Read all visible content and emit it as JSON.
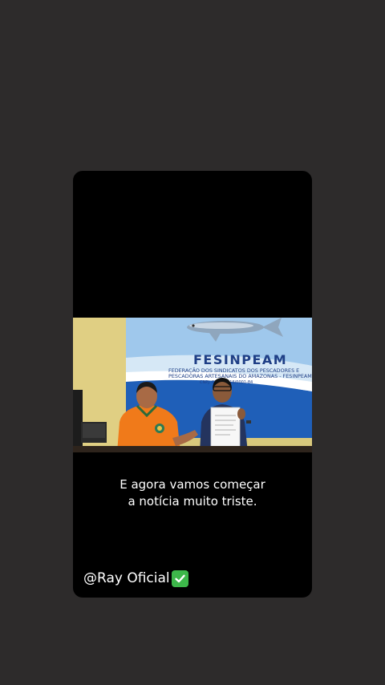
{
  "video": {
    "banner_title": "FESINPEAM",
    "banner_line1": "FEDERAÇÃO DOS SINDICATOS DOS PESCADORES E",
    "banner_line2": "PESCADORAS ARTESANAIS DO AMAZONAS - FESINPEAM",
    "banner_line3": "CNPJ: 07.378.116/0001-84"
  },
  "caption": {
    "line1": "E agora vamos começar",
    "line2": "a notícia muito triste."
  },
  "overlay": {
    "handle": "@Ray Oficial",
    "verified_icon": "check-mark-button-icon"
  },
  "colors": {
    "page_background": "#2d2b2b",
    "card_background": "#000000",
    "banner_blue": "#1f5fb8",
    "verified_green": "#3db84a"
  }
}
